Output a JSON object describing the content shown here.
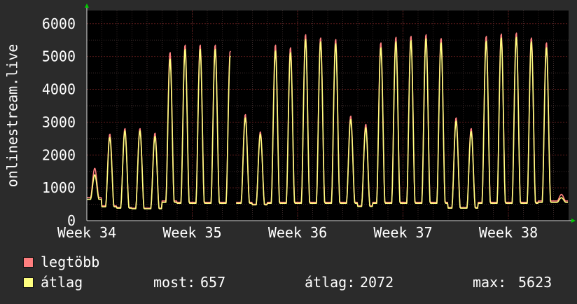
{
  "chart_data": {
    "type": "line",
    "ylabel": "onlinestream.live",
    "ylim": [
      0,
      6400
    ],
    "yticks": [
      "0",
      "1000",
      "2000",
      "3000",
      "4000",
      "5000",
      "6000"
    ],
    "xticks": [
      "Week 34",
      "Week 35",
      "Week 36",
      "Week 37",
      "Week 38"
    ],
    "grid": true,
    "colors": {
      "background": "#2b2b2b",
      "plot_background": "#000000",
      "grid_major": "#5a1a1a",
      "grid_minor": "#3a2a2a",
      "max_series": "#ff7f7f",
      "avg_series": "#ffff7f",
      "axis_arrow": "#00cc00"
    },
    "series": [
      {
        "name": "legtöbb",
        "daily_peaks": [
          1600,
          2650,
          2820,
          2820,
          2680,
          5150,
          5380,
          5380,
          5380,
          5200,
          3250,
          2720,
          5380,
          5300,
          5700,
          5600,
          5550,
          3200,
          2950,
          5450,
          5620,
          5650,
          5700,
          5580,
          3150,
          2820,
          5650,
          5720,
          5750,
          5600,
          5450,
          800
        ],
        "daily_troughs": [
          700,
          450,
          400,
          380,
          380,
          600,
          560,
          560,
          560,
          560,
          560,
          500,
          560,
          560,
          560,
          560,
          560,
          560,
          450,
          560,
          560,
          560,
          560,
          560,
          400,
          400,
          560,
          560,
          560,
          560,
          600,
          600
        ]
      },
      {
        "name": "átlag",
        "daily_peaks": [
          1400,
          2550,
          2750,
          2750,
          2580,
          4950,
          5250,
          5250,
          5250,
          5050,
          3150,
          2650,
          5200,
          5150,
          5550,
          5480,
          5420,
          3100,
          2850,
          5300,
          5480,
          5520,
          5580,
          5450,
          3050,
          2730,
          5500,
          5600,
          5620,
          5480,
          5300,
          700
        ],
        "daily_troughs": [
          650,
          420,
          380,
          360,
          360,
          560,
          530,
          530,
          530,
          530,
          530,
          480,
          530,
          530,
          530,
          530,
          530,
          530,
          430,
          530,
          530,
          530,
          530,
          530,
          380,
          380,
          530,
          530,
          530,
          530,
          560,
          560
        ]
      }
    ],
    "gap_after_day": 9
  },
  "legend": {
    "max_label": "legtöbb",
    "avg_label": "átlag",
    "most_label": "most:",
    "most_value": "657",
    "avg_stat_label": "átlag:",
    "avg_stat_value": "2072",
    "max_stat_label": "max:",
    "max_stat_value": "5623"
  }
}
